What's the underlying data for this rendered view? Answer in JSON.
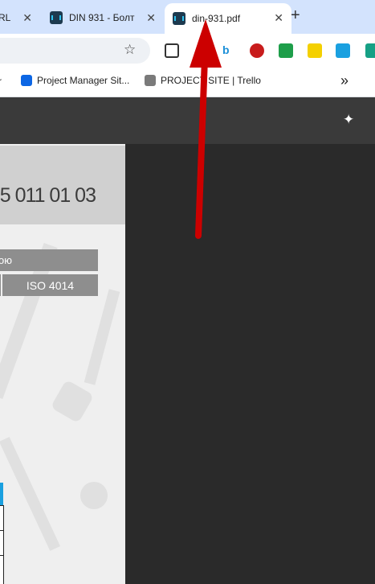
{
  "tabs": [
    {
      "title": "RL",
      "active": false
    },
    {
      "title": "DIN 931 - Болт",
      "active": false
    },
    {
      "title": "din-931.pdf",
      "active": true
    }
  ],
  "new_tab": "+",
  "bookmarks": {
    "items": [
      {
        "label": "Project Manager Sit..."
      },
      {
        "label": "PROJECT SITE | Trello"
      }
    ],
    "overflow": "»"
  },
  "document": {
    "code": "5 011 01 03",
    "cell_top": "ою",
    "cell_standard": "ISO 4014"
  },
  "icons": {
    "star": "bookmark-star-icon",
    "sparkle": "sparkle-icon"
  },
  "colors": {
    "tab_strip": "#d3e3fd",
    "annotation_arrow": "#cc0000",
    "pdf_background": "#2a2a2a",
    "table_header": "#8e8e8e"
  }
}
